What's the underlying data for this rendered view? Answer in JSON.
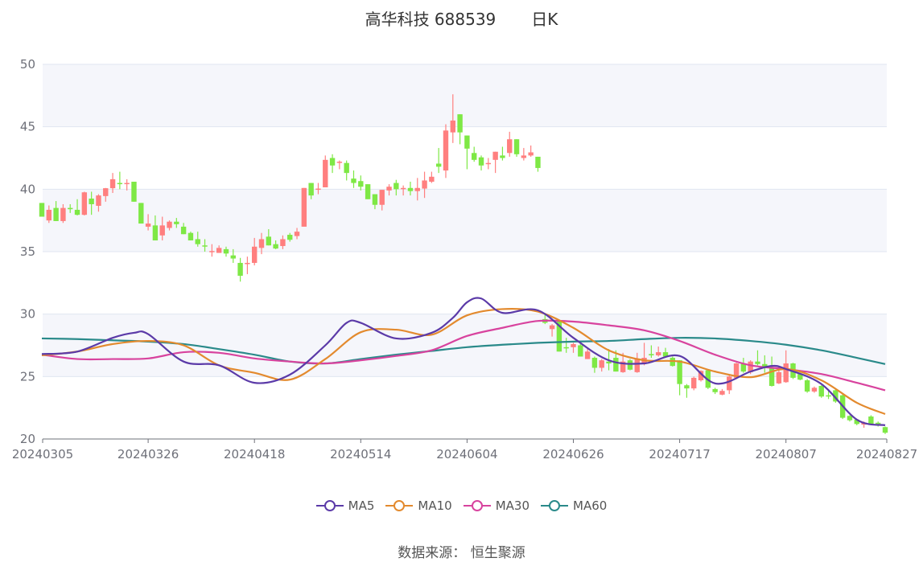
{
  "title": {
    "name": "高华科技 688539",
    "period": "日K"
  },
  "footer": {
    "source": "数据来源：  恒生聚源"
  },
  "chart_data": {
    "type": "candlestick",
    "title": "高华科技 688539 日K",
    "ylim": [
      20,
      50
    ],
    "yticks": [
      "20",
      "25",
      "30",
      "35",
      "40",
      "45",
      "50"
    ],
    "ytick_values": [
      20,
      25,
      30,
      35,
      40,
      45,
      50
    ],
    "xtick_labels": [
      "20240305",
      "20240326",
      "20240418",
      "20240514",
      "20240604",
      "20240626",
      "20240717",
      "20240807",
      "20240827"
    ],
    "xtick_indices": [
      0,
      15,
      30,
      45,
      60,
      75,
      90,
      105,
      119
    ],
    "candle_count": 120,
    "candle_format": [
      "open",
      "close",
      "low",
      "high"
    ],
    "colors": {
      "up": "#ff7f7f",
      "down": "#7ee845",
      "grid": "#e0e6f1",
      "band": "#f5f6fb",
      "axis": "#6e7079"
    },
    "candles": [
      [
        38.9,
        37.8,
        37.8,
        38.9
      ],
      [
        37.5,
        38.35,
        37.3,
        38.7
      ],
      [
        38.5,
        37.45,
        37.45,
        39.05
      ],
      [
        37.45,
        38.5,
        37.3,
        38.8
      ],
      [
        38.5,
        38.4,
        38.1,
        38.8
      ],
      [
        38.35,
        37.95,
        37.9,
        39.2
      ],
      [
        37.95,
        39.75,
        37.9,
        39.8
      ],
      [
        39.25,
        38.8,
        37.95,
        39.8
      ],
      [
        38.67,
        39.5,
        38.2,
        39.6
      ],
      [
        39.45,
        40.08,
        39.0,
        40.1
      ],
      [
        40.08,
        40.8,
        39.7,
        41.3
      ],
      [
        40.5,
        40.45,
        40.0,
        41.4
      ],
      [
        40.45,
        40.5,
        39.9,
        40.8
      ],
      [
        40.6,
        39.0,
        39.0,
        40.6
      ],
      [
        38.9,
        37.25,
        37.25,
        38.9
      ],
      [
        37.0,
        37.25,
        36.7,
        38.0
      ],
      [
        37.1,
        35.9,
        35.9,
        37.9
      ],
      [
        36.3,
        37.1,
        35.9,
        37.8
      ],
      [
        36.9,
        37.4,
        36.7,
        37.5
      ],
      [
        37.4,
        37.2,
        36.9,
        37.7
      ],
      [
        37.0,
        36.4,
        36.4,
        37.3
      ],
      [
        36.5,
        35.9,
        35.9,
        36.6
      ],
      [
        36.0,
        35.6,
        35.4,
        36.6
      ],
      [
        35.5,
        35.45,
        35.0,
        36.0
      ],
      [
        35.0,
        35.05,
        34.6,
        35.6
      ],
      [
        34.9,
        35.3,
        34.9,
        35.5
      ],
      [
        35.2,
        34.85,
        34.6,
        35.4
      ],
      [
        34.7,
        34.45,
        34.1,
        35.2
      ],
      [
        34.1,
        33.07,
        32.6,
        34.5
      ],
      [
        34.05,
        34.1,
        33.2,
        34.6
      ],
      [
        34.1,
        35.4,
        33.9,
        36.1
      ],
      [
        35.3,
        36.0,
        34.8,
        36.5
      ],
      [
        36.2,
        35.5,
        35.5,
        36.8
      ],
      [
        35.6,
        35.25,
        35.2,
        35.9
      ],
      [
        35.45,
        36.0,
        35.2,
        36.3
      ],
      [
        36.35,
        35.95,
        35.8,
        36.5
      ],
      [
        36.25,
        36.6,
        36.0,
        36.9
      ],
      [
        37.0,
        40.1,
        37.0,
        40.1
      ],
      [
        40.5,
        39.5,
        39.2,
        40.5
      ],
      [
        40.0,
        40.05,
        39.6,
        40.5
      ],
      [
        40.15,
        42.35,
        40.15,
        42.7
      ],
      [
        42.5,
        41.9,
        41.3,
        42.8
      ],
      [
        42.15,
        42.2,
        41.6,
        42.3
      ],
      [
        42.1,
        41.3,
        40.7,
        42.3
      ],
      [
        40.85,
        40.5,
        40.1,
        41.5
      ],
      [
        40.65,
        40.2,
        39.9,
        41.1
      ],
      [
        40.4,
        39.2,
        39.2,
        40.4
      ],
      [
        39.6,
        38.75,
        38.4,
        39.6
      ],
      [
        38.75,
        39.95,
        38.3,
        39.95
      ],
      [
        39.9,
        40.2,
        39.5,
        40.4
      ],
      [
        40.5,
        40.0,
        39.5,
        40.75
      ],
      [
        40.05,
        40.1,
        39.5,
        40.3
      ],
      [
        40.1,
        39.85,
        39.5,
        40.6
      ],
      [
        39.85,
        40.1,
        39.1,
        40.9
      ],
      [
        40.05,
        40.7,
        39.3,
        41.4
      ],
      [
        40.6,
        41.0,
        40.5,
        41.4
      ],
      [
        42.05,
        41.8,
        41.3,
        43.3
      ],
      [
        41.5,
        44.7,
        40.9,
        45.2
      ],
      [
        44.55,
        45.5,
        43.7,
        47.6
      ],
      [
        46.0,
        44.55,
        43.6,
        46.0
      ],
      [
        44.3,
        43.25,
        41.6,
        44.3
      ],
      [
        42.9,
        42.35,
        42.2,
        43.4
      ],
      [
        42.55,
        41.9,
        41.5,
        42.7
      ],
      [
        42.05,
        42.1,
        41.6,
        42.5
      ],
      [
        42.35,
        43.0,
        41.3,
        43.0
      ],
      [
        42.7,
        42.5,
        42.3,
        43.4
      ],
      [
        42.9,
        44.0,
        42.6,
        44.6
      ],
      [
        44.0,
        42.8,
        42.6,
        44.0
      ],
      [
        42.5,
        42.7,
        42.3,
        43.3
      ],
      [
        42.7,
        42.95,
        42.6,
        43.5
      ],
      [
        42.6,
        41.7,
        41.4,
        42.6
      ],
      [
        29.6,
        29.3,
        29.2,
        30.0
      ],
      [
        28.8,
        29.1,
        28.2,
        29.2
      ],
      [
        29.4,
        27.0,
        27.0,
        29.4
      ],
      [
        27.35,
        27.3,
        26.9,
        28.1
      ],
      [
        27.35,
        27.6,
        26.9,
        27.7
      ],
      [
        27.5,
        26.6,
        26.6,
        27.6
      ],
      [
        26.4,
        27.0,
        26.4,
        27.3
      ],
      [
        26.5,
        25.7,
        25.3,
        26.6
      ],
      [
        25.7,
        26.3,
        25.4,
        26.4
      ],
      [
        26.2,
        26.05,
        25.5,
        27.2
      ],
      [
        26.5,
        25.4,
        25.4,
        27.1
      ],
      [
        25.35,
        26.2,
        25.3,
        26.9
      ],
      [
        26.3,
        25.55,
        25.5,
        26.4
      ],
      [
        25.35,
        26.4,
        25.3,
        26.9
      ],
      [
        26.05,
        26.5,
        25.9,
        27.7
      ],
      [
        26.8,
        26.7,
        26.5,
        27.5
      ],
      [
        26.7,
        26.95,
        26.6,
        27.4
      ],
      [
        26.95,
        26.6,
        26.5,
        27.3
      ],
      [
        26.5,
        25.85,
        25.8,
        26.6
      ],
      [
        26.3,
        24.4,
        23.5,
        26.3
      ],
      [
        24.3,
        24.05,
        23.3,
        24.4
      ],
      [
        24.05,
        24.9,
        23.9,
        25.0
      ],
      [
        24.7,
        25.45,
        24.6,
        25.5
      ],
      [
        25.5,
        24.1,
        24.0,
        25.6
      ],
      [
        24.0,
        23.75,
        23.6,
        24.1
      ],
      [
        23.55,
        23.85,
        23.5,
        24.0
      ],
      [
        23.9,
        25.0,
        23.6,
        25.1
      ],
      [
        24.9,
        26.05,
        24.8,
        26.1
      ],
      [
        26.05,
        25.4,
        25.3,
        26.5
      ],
      [
        25.35,
        26.2,
        25.2,
        26.3
      ],
      [
        26.2,
        26.0,
        25.9,
        27.1
      ],
      [
        26.0,
        25.8,
        25.3,
        26.7
      ],
      [
        25.7,
        24.25,
        24.2,
        26.6
      ],
      [
        24.45,
        25.35,
        24.4,
        25.5
      ],
      [
        24.55,
        26.05,
        24.5,
        27.1
      ],
      [
        26.05,
        24.9,
        24.8,
        26.1
      ],
      [
        25.2,
        24.75,
        24.7,
        25.3
      ],
      [
        24.7,
        23.8,
        23.7,
        24.8
      ],
      [
        23.8,
        24.1,
        23.7,
        24.2
      ],
      [
        24.25,
        23.4,
        23.3,
        24.3
      ],
      [
        23.5,
        23.4,
        23.2,
        24.0
      ],
      [
        23.9,
        23.0,
        22.9,
        24.0
      ],
      [
        23.5,
        21.7,
        21.6,
        23.6
      ],
      [
        21.85,
        21.5,
        21.4,
        21.9
      ],
      [
        21.55,
        21.2,
        21.1,
        21.6
      ],
      [
        21.15,
        21.3,
        20.9,
        21.4
      ],
      [
        21.8,
        21.2,
        21.1,
        21.9
      ],
      [
        21.3,
        21.2,
        21.0,
        21.4
      ],
      [
        20.95,
        20.5,
        20.4,
        21.0
      ]
    ],
    "series": [
      {
        "name": "MA5",
        "color": "#5b3aa8",
        "x": [
          0,
          5,
          10,
          13,
          15,
          20,
          25,
          30,
          35,
          40,
          43,
          45,
          50,
          55,
          58,
          60,
          62,
          65,
          70,
          75,
          80,
          85,
          90,
          95,
          100,
          103,
          105,
          110,
          115,
          119
        ],
        "values": [
          26.8,
          27.0,
          28.1,
          28.5,
          28.4,
          26.2,
          25.9,
          24.5,
          25.15,
          27.5,
          29.3,
          29.3,
          28.05,
          28.5,
          29.7,
          30.95,
          31.25,
          30.1,
          30.3,
          28.1,
          26.3,
          26.05,
          26.65,
          24.45,
          25.4,
          25.85,
          25.6,
          24.4,
          21.55,
          21.1
        ]
      },
      {
        "name": "MA10",
        "color": "#e38a2e",
        "x": [
          0,
          5,
          10,
          15,
          20,
          25,
          30,
          35,
          40,
          45,
          50,
          55,
          60,
          65,
          70,
          75,
          80,
          85,
          90,
          95,
          100,
          105,
          110,
          115,
          119
        ],
        "values": [
          26.7,
          27.0,
          27.6,
          27.85,
          27.5,
          25.9,
          25.3,
          24.75,
          26.4,
          28.55,
          28.75,
          28.35,
          29.9,
          30.4,
          30.2,
          28.9,
          27.1,
          26.3,
          26.2,
          25.4,
          24.95,
          25.6,
          24.7,
          22.9,
          22.0
        ]
      },
      {
        "name": "MA30",
        "color": "#d8439e",
        "x": [
          0,
          5,
          10,
          15,
          20,
          25,
          30,
          35,
          40,
          45,
          50,
          55,
          60,
          65,
          70,
          75,
          80,
          85,
          90,
          95,
          100,
          105,
          110,
          115,
          119
        ],
        "values": [
          26.75,
          26.4,
          26.4,
          26.45,
          26.95,
          26.9,
          26.45,
          26.2,
          26.05,
          26.3,
          26.65,
          27.1,
          28.25,
          28.9,
          29.45,
          29.4,
          29.1,
          28.7,
          27.85,
          26.75,
          25.9,
          25.6,
          25.2,
          24.5,
          23.9
        ]
      },
      {
        "name": "MA60",
        "color": "#2a8a8a",
        "x": [
          0,
          5,
          10,
          15,
          20,
          25,
          30,
          35,
          40,
          45,
          50,
          55,
          60,
          65,
          70,
          75,
          80,
          85,
          90,
          95,
          100,
          105,
          110,
          115,
          119
        ],
        "values": [
          28.05,
          28.0,
          27.9,
          27.8,
          27.6,
          27.2,
          26.75,
          26.2,
          26.05,
          26.4,
          26.75,
          27.05,
          27.35,
          27.55,
          27.7,
          27.8,
          27.85,
          28.0,
          28.1,
          28.05,
          27.85,
          27.55,
          27.1,
          26.5,
          26.0
        ]
      }
    ],
    "legend": [
      "MA5",
      "MA10",
      "MA30",
      "MA60"
    ],
    "legend_position": "bottom"
  }
}
